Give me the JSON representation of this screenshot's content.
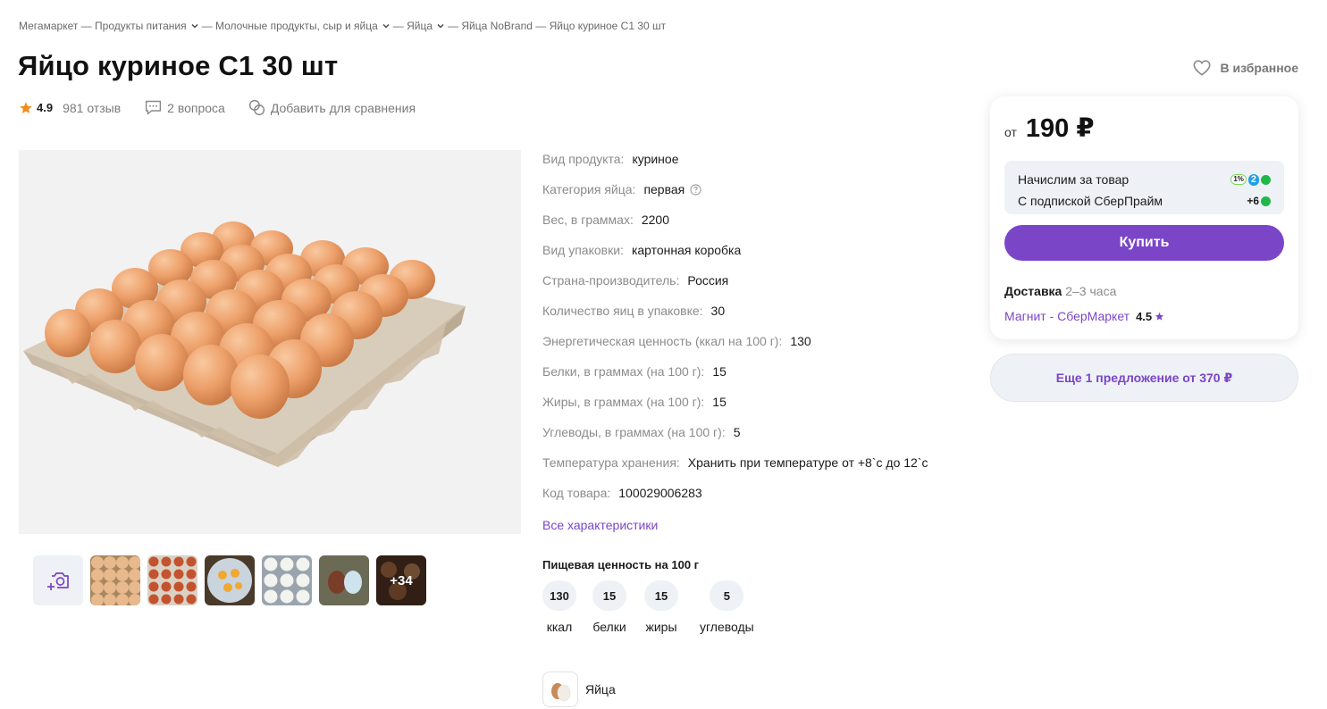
{
  "breadcrumb": {
    "items": [
      "Мегамаркет — Продукты питания",
      "— Молочные продукты, сыр и яйца",
      "— Яйца",
      "— Яйца NoBrand — Яйцо куриное С1 30 шт"
    ]
  },
  "product": {
    "title": "Яйцо куриное С1 30 шт",
    "rating": "4.9",
    "reviews": "981 отзыв",
    "questions": "2 вопроса",
    "compare": "Добавить для сравнения",
    "favorite": "В избранное"
  },
  "specs": [
    {
      "name": "Вид продукта:",
      "value": "куриное"
    },
    {
      "name": "Категория яйца:",
      "value": "первая"
    },
    {
      "name": "Вес, в граммах:",
      "value": "2200"
    },
    {
      "name": "Вид упаковки:",
      "value": "картонная коробка"
    },
    {
      "name": "Страна-производитель:",
      "value": "Россия"
    },
    {
      "name": "Количество яиц в упаковке:",
      "value": "30"
    },
    {
      "name": "Энергетическая ценность (ккал на 100 г):",
      "value": "130"
    },
    {
      "name": "Белки, в граммах (на 100 г):",
      "value": "15"
    },
    {
      "name": "Жиры, в граммах (на 100 г):",
      "value": "15"
    },
    {
      "name": "Углеводы, в граммах (на 100 г):",
      "value": "5"
    },
    {
      "name": "Температура хранения:",
      "value": "Хранить при температуре от +8`c до 12`c"
    },
    {
      "name": "Код товара:",
      "value": "100029006283"
    }
  ],
  "all_specs_link": "Все характеристики",
  "nutrition": {
    "title": "Пищевая ценность на 100 г",
    "items": [
      {
        "value": "130",
        "label": "ккал"
      },
      {
        "value": "15",
        "label": "белки"
      },
      {
        "value": "15",
        "label": "жиры"
      },
      {
        "value": "5",
        "label": "углеводы"
      }
    ]
  },
  "thumbnails": {
    "more_count": "+34"
  },
  "category_chip": "Яйца",
  "offer": {
    "price_from": "от",
    "price": "190 ₽",
    "bonus_label": "Начислим за товар",
    "bonus_pct": "1%",
    "bonus_value": "2",
    "prime_label": "С подпиской СберПрайм",
    "prime_value": "+6",
    "buy_label": "Купить",
    "delivery_label": "Доставка",
    "delivery_time": "2–3 часа",
    "seller": "Магнит - СберМаркет",
    "seller_rating": "4.5",
    "more_offers": "Еще 1 предложение от 370 ₽"
  },
  "colors": {
    "accent": "#7b45c8",
    "star": "#f28c1c",
    "bonus_green": "#21b84a"
  }
}
